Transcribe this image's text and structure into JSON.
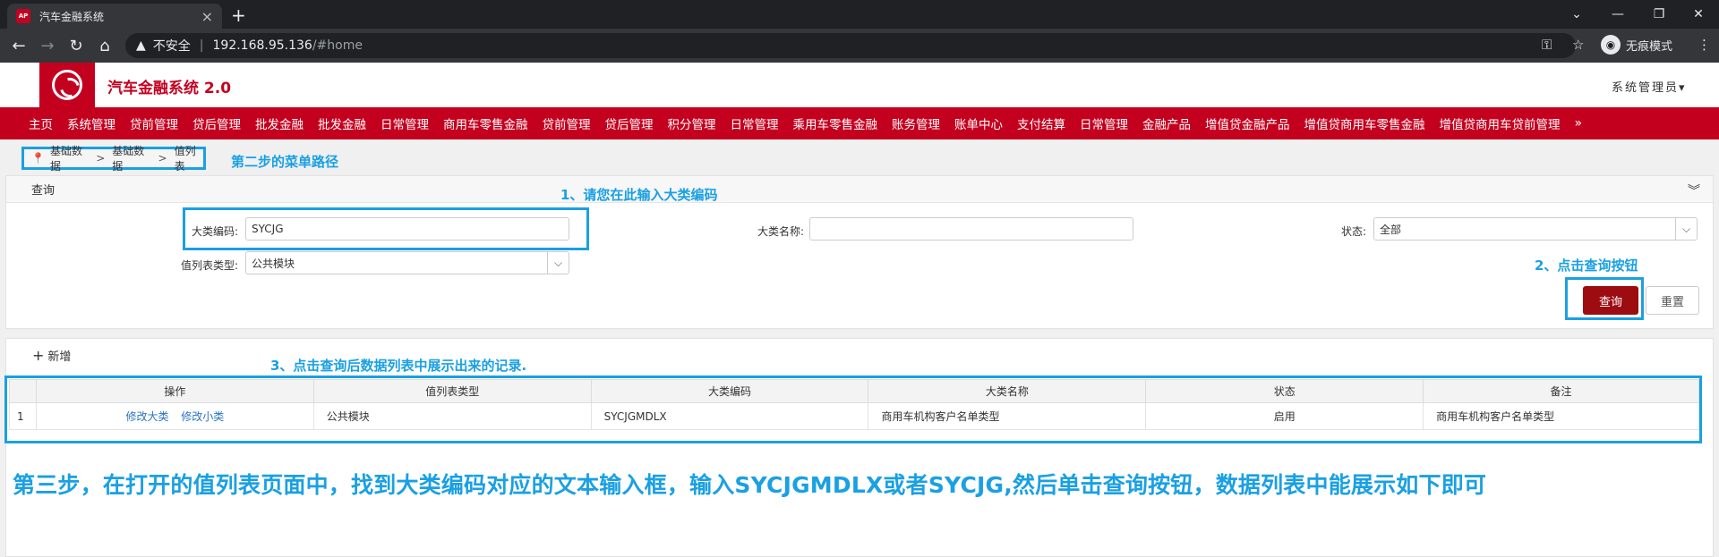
{
  "browser": {
    "tab_title": "汽车金融系统",
    "favicon_text": "AP",
    "security_label": "不安全",
    "url_host": "192.168.95.136",
    "url_path": "/#home",
    "incognito_label": "无痕模式"
  },
  "app": {
    "title": "汽车金融系统 2.0",
    "user": "系统管理员",
    "brand_color": "#c4001f"
  },
  "menu": [
    "主页",
    "系统管理",
    "贷前管理",
    "贷后管理",
    "批发金融",
    "批发金融",
    "日常管理",
    "商用车零售金融",
    "贷前管理",
    "贷后管理",
    "积分管理",
    "日常管理",
    "乘用车零售金融",
    "账务管理",
    "账单中心",
    "支付结算",
    "日常管理",
    "金融产品",
    "增值贷金融产品",
    "增值贷商用车零售金融",
    "增值贷商用车贷前管理"
  ],
  "menu_more": "»",
  "breadcrumb": [
    "基础数据",
    "基础数据",
    "值列表"
  ],
  "annotations": {
    "step2": "第二步的菜单路径",
    "a1": "1、请您在此输入大类编码",
    "a2": "2、点击查询按钮",
    "a3": "3、点击查询后数据列表中展示出来的记录.",
    "step3": "第三步，在打开的值列表页面中，找到大类编码对应的文本输入框，输入SYCJGMDLX或者SYCJG,然后单击查询按钮，数据列表中能展示如下即可"
  },
  "query": {
    "panel_title": "查询",
    "code_label": "大类编码:",
    "code_value": "SYCJG",
    "name_label": "大类名称:",
    "name_value": "",
    "status_label": "状态:",
    "status_value": "全部",
    "type_label": "值列表类型:",
    "type_value": "公共模块",
    "search_button": "查询",
    "reset_button": "重置"
  },
  "results": {
    "add_label": "新增",
    "columns": [
      "操作",
      "值列表类型",
      "大类编码",
      "大类名称",
      "状态",
      "备注"
    ],
    "rows": [
      {
        "index": "1",
        "actions": [
          "修改大类",
          "修改小类"
        ],
        "type": "公共模块",
        "code": "SYCJGMDLX",
        "name": "商用车机构客户名单类型",
        "status": "启用",
        "remark": "商用车机构客户名单类型"
      }
    ]
  }
}
